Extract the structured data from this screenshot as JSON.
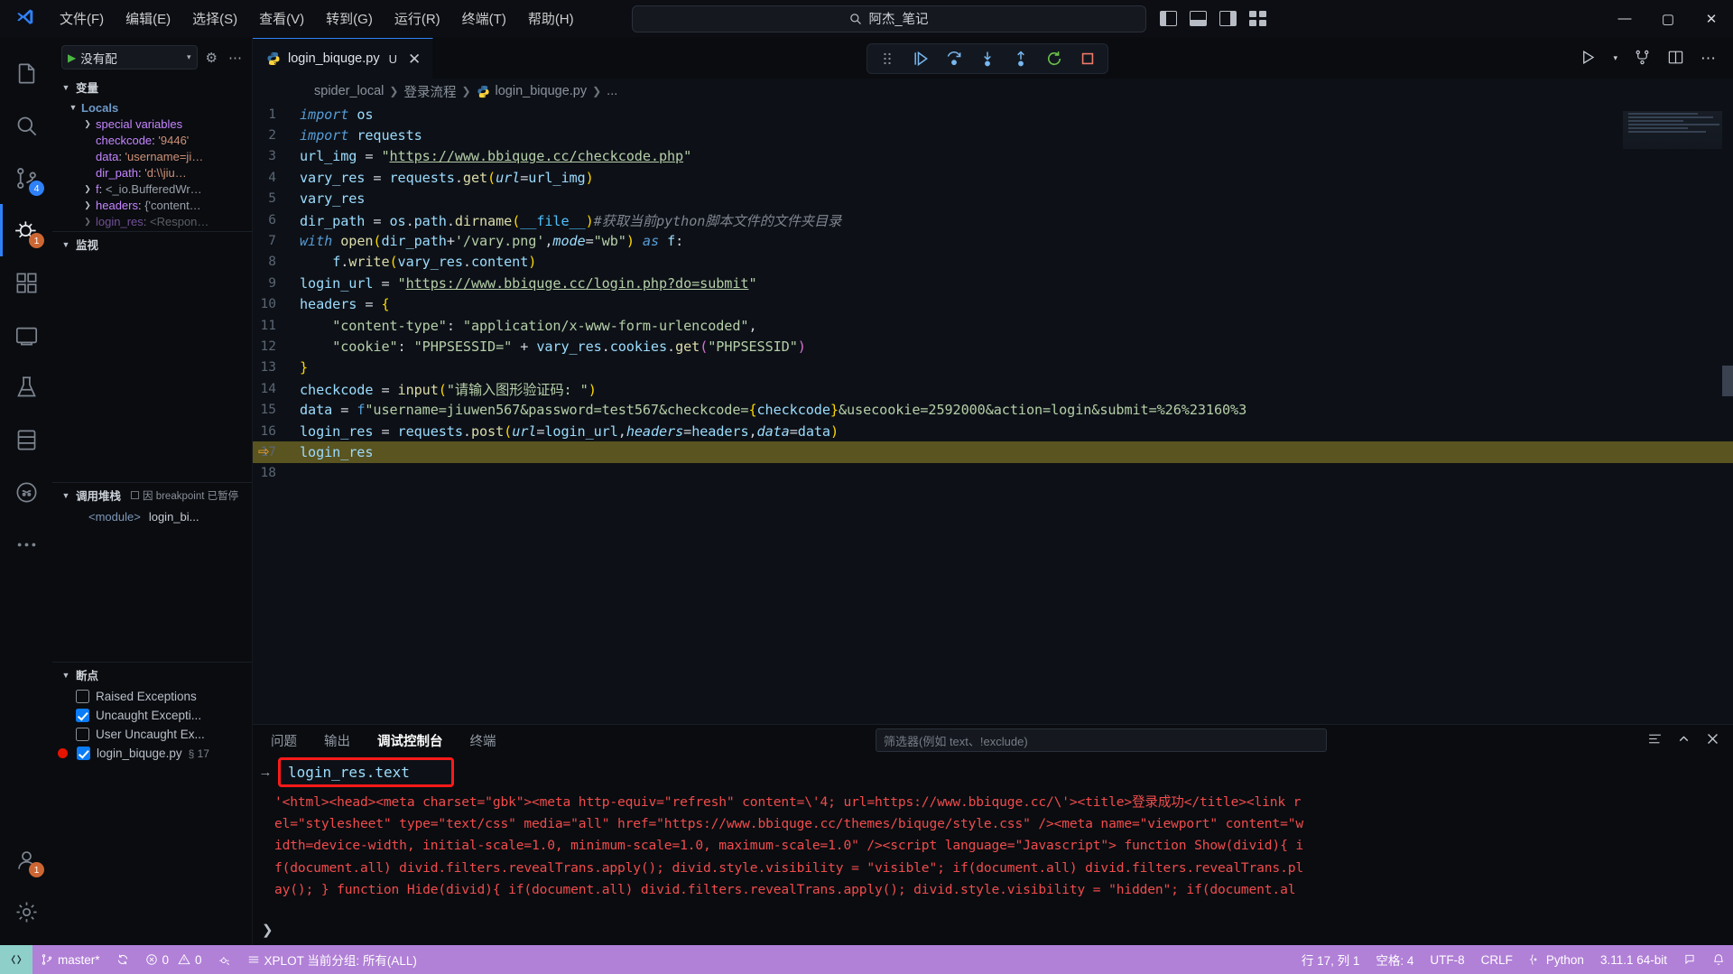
{
  "titlebar": {
    "menus": [
      "文件(F)",
      "编辑(E)",
      "选择(S)",
      "查看(V)",
      "转到(G)",
      "运行(R)",
      "终端(T)",
      "帮助(H)"
    ],
    "back_arrow": "←",
    "forward_arrow": "→",
    "search_value": "阿杰_笔记",
    "minimize": "—",
    "maximize": "▢",
    "close": "✕"
  },
  "activitybar": {
    "items": [
      {
        "name": "explorer",
        "badge": ""
      },
      {
        "name": "search",
        "badge": ""
      },
      {
        "name": "source-control",
        "badge": "4"
      },
      {
        "name": "run-and-debug",
        "badge": "1"
      },
      {
        "name": "extensions",
        "badge": ""
      },
      {
        "name": "remote-explorer",
        "badge": ""
      },
      {
        "name": "testing",
        "badge": ""
      },
      {
        "name": "database",
        "badge": ""
      },
      {
        "name": "copilot",
        "badge": ""
      },
      {
        "name": "more-views",
        "badge": ""
      }
    ],
    "accounts_badge": "1"
  },
  "sidebar": {
    "config_label": "没有配",
    "sections": {
      "variables_title": "变量",
      "locals_title": "Locals",
      "watch_title": "监视",
      "callstack_title": "调用堆栈",
      "callstack_reason": "因 breakpoint 已暂停",
      "breakpoints_title": "断点"
    },
    "variables": [
      {
        "name": "special variables",
        "value": "",
        "expandable": true
      },
      {
        "name": "checkcode",
        "value": "'9446'",
        "expandable": false
      },
      {
        "name": "data",
        "value": "'username=ji…",
        "expandable": false
      },
      {
        "name": "dir_path",
        "value": "'d:\\\\jiu…",
        "expandable": false
      },
      {
        "name": "f",
        "value": "<_io.BufferedWr…",
        "expandable": true
      },
      {
        "name": "headers",
        "value": "{'content…",
        "expandable": true
      },
      {
        "name": "login_res",
        "value": "<Respon…",
        "expandable": true
      }
    ],
    "callstack": [
      {
        "frame": "<module>",
        "file": "login_bi..."
      }
    ],
    "breakpoints": [
      {
        "label": "Raised Exceptions",
        "checked": false,
        "dot": false,
        "line": ""
      },
      {
        "label": "Uncaught Excepti...",
        "checked": true,
        "dot": false,
        "line": ""
      },
      {
        "label": "User Uncaught Ex...",
        "checked": false,
        "dot": false,
        "line": ""
      },
      {
        "label": "login_biquge.py",
        "checked": true,
        "dot": true,
        "line": "§ 17"
      }
    ]
  },
  "editor": {
    "tab": {
      "filename": "login_biquge.py",
      "modified_mark": "U"
    },
    "breadcrumb": [
      "spider_local",
      "登录流程",
      "login_biquge.py",
      "..."
    ],
    "current_line": 17,
    "lines": [
      {
        "n": 1,
        "html": "<span class=\"kw\">import</span> <span class=\"var\">os</span>"
      },
      {
        "n": 2,
        "html": "<span class=\"kw\">import</span> <span class=\"var\">requests</span>"
      },
      {
        "n": 3,
        "html": "<span class=\"var\">url_img</span> <span class=\"op\">=</span> <span class=\"str\">\"</span><span class=\"link\">https://www.bbiquge.cc/checkcode.php</span><span class=\"str\">\"</span>"
      },
      {
        "n": 4,
        "html": "<span class=\"var\">vary_res</span> <span class=\"op\">=</span> <span class=\"var\">requests</span><span class=\"op\">.</span><span class=\"fn\">get</span><span class=\"par\">(</span><span class=\"kw2\" style=\"font-style:italic;color:#9cdcfe\">url</span><span class=\"op\">=</span><span class=\"var\">url_img</span><span class=\"par\">)</span>"
      },
      {
        "n": 5,
        "html": "<span class=\"var\">vary_res</span>"
      },
      {
        "n": 6,
        "html": "<span class=\"var\">dir_path</span> <span class=\"op\">=</span> <span class=\"var\">os</span><span class=\"op\">.</span><span class=\"var\">path</span><span class=\"op\">.</span><span class=\"fn\">dirname</span><span class=\"par\">(</span><span class=\"builtin\">__file__</span><span class=\"par\">)</span><span class=\"cmt\">#获取当前python脚本文件的文件夹目录</span>"
      },
      {
        "n": 7,
        "html": "<span class=\"kw\">with</span> <span class=\"fn\">open</span><span class=\"par\">(</span><span class=\"var\">dir_path</span><span class=\"op\">+</span><span class=\"str\">'/vary.png'</span><span class=\"op\">,</span><span style=\"font-style:italic;color:#9cdcfe\">mode</span><span class=\"op\">=</span><span class=\"str\">\"wb\"</span><span class=\"par\">)</span> <span class=\"kw\">as</span> <span class=\"var\">f</span><span class=\"op\">:</span>"
      },
      {
        "n": 8,
        "html": "    <span class=\"var\">f</span><span class=\"op\">.</span><span class=\"fn\">write</span><span class=\"par\">(</span><span class=\"var\">vary_res</span><span class=\"op\">.</span><span class=\"var\">content</span><span class=\"par\">)</span>"
      },
      {
        "n": 9,
        "html": "<span class=\"var\">login_url</span> <span class=\"op\">=</span> <span class=\"str\">\"</span><span class=\"link\">https://www.bbiquge.cc/login.php?do=submit</span><span class=\"str\">\"</span>"
      },
      {
        "n": 10,
        "html": "<span class=\"var\">headers</span> <span class=\"op\">=</span> <span class=\"par\">{</span>"
      },
      {
        "n": 11,
        "html": "    <span class=\"str\">\"content-type\"</span><span class=\"op\">:</span> <span class=\"str\">\"application/x-www-form-urlencoded\"</span><span class=\"op\">,</span>"
      },
      {
        "n": 12,
        "html": "    <span class=\"str\">\"cookie\"</span><span class=\"op\">:</span> <span class=\"str\">\"PHPSESSID=\"</span> <span class=\"op\">+</span> <span class=\"var\">vary_res</span><span class=\"op\">.</span><span class=\"var\">cookies</span><span class=\"op\">.</span><span class=\"fn\">get</span><span class=\"par2\">(</span><span class=\"str\">\"PHPSESSID\"</span><span class=\"par2\">)</span>"
      },
      {
        "n": 13,
        "html": "<span class=\"par\">}</span>"
      },
      {
        "n": 14,
        "html": "<span class=\"var\">checkcode</span> <span class=\"op\">=</span> <span class=\"fn\">input</span><span class=\"par\">(</span><span class=\"str\">\"请输入图形验证码: \"</span><span class=\"par\">)</span>"
      },
      {
        "n": 15,
        "html": "<span class=\"var\">data</span> <span class=\"op\">=</span> <span class=\"fstr\">f</span><span class=\"str\">\"username=jiuwen567&password=test567&checkcode=</span><span class=\"par\">{</span><span class=\"var\">checkcode</span><span class=\"par\">}</span><span class=\"str\">&usecookie=2592000&action=login&submit=%26%23160%3</span>"
      },
      {
        "n": 16,
        "html": "<span class=\"var\">login_res</span> <span class=\"op\">=</span> <span class=\"var\">requests</span><span class=\"op\">.</span><span class=\"fn\">post</span><span class=\"par\">(</span><span style=\"font-style:italic;color:#9cdcfe\">url</span><span class=\"op\">=</span><span class=\"var\">login_url</span><span class=\"op\">,</span><span style=\"font-style:italic;color:#9cdcfe\">headers</span><span class=\"op\">=</span><span class=\"var\">headers</span><span class=\"op\">,</span><span style=\"font-style:italic;color:#9cdcfe\">data</span><span class=\"op\">=</span><span class=\"var\">data</span><span class=\"par\">)</span>"
      },
      {
        "n": 17,
        "html": "<span class=\"var\">login_res</span>",
        "highlight": true
      },
      {
        "n": 18,
        "html": ""
      }
    ]
  },
  "panel": {
    "tabs": [
      "问题",
      "输出",
      "调试控制台",
      "终端"
    ],
    "active_tab": "调试控制台",
    "filter_placeholder": "筛选器(例如 text、!exclude)",
    "repl_prompt": "→",
    "repl_value": "login_res.text",
    "output_lines": [
      "'<html><head><meta charset=\"gbk\"><meta http-equiv=\"refresh\" content=\\'4; url=https://www.bbiquge.cc/\\'><title>登录成功</title><link r",
      "el=\"stylesheet\" type=\"text/css\" media=\"all\" href=\"https://www.bbiquge.cc/themes/biquge/style.css\" /><meta name=\"viewport\" content=\"w",
      "idth=device-width, initial-scale=1.0, minimum-scale=1.0, maximum-scale=1.0\" /><script language=\"Javascript\"> function Show(divid){ i",
      "f(document.all) divid.filters.revealTrans.apply(); divid.style.visibility = \"visible\"; if(document.all) divid.filters.revealTrans.pl",
      "ay(); } function Hide(divid){ if(document.all) divid.filters.revealTrans.apply(); divid.style.visibility = \"hidden\"; if(document.al"
    ]
  },
  "statusbar": {
    "remote_icon": "remote-window-icon",
    "branch": "master*",
    "sync_icon": "sync-icon",
    "errors": "0",
    "warnings": "0",
    "xplot": "XPLOT 当前分组: 所有(ALL)",
    "cursor": "行 17, 列 1",
    "indent": "空格: 4",
    "encoding": "UTF-8",
    "eol": "CRLF",
    "language": "Python",
    "interpreter": "3.11.1 64-bit"
  },
  "colors": {
    "accent": "#2f81f7",
    "statusbar_debug": "#b180d7",
    "remote": "#8ecfc9",
    "breakpoint": "#e51400",
    "highlight_line": "#5a5420",
    "repl_box_border": "#ff1a1a",
    "output_text": "#f14c4c"
  }
}
